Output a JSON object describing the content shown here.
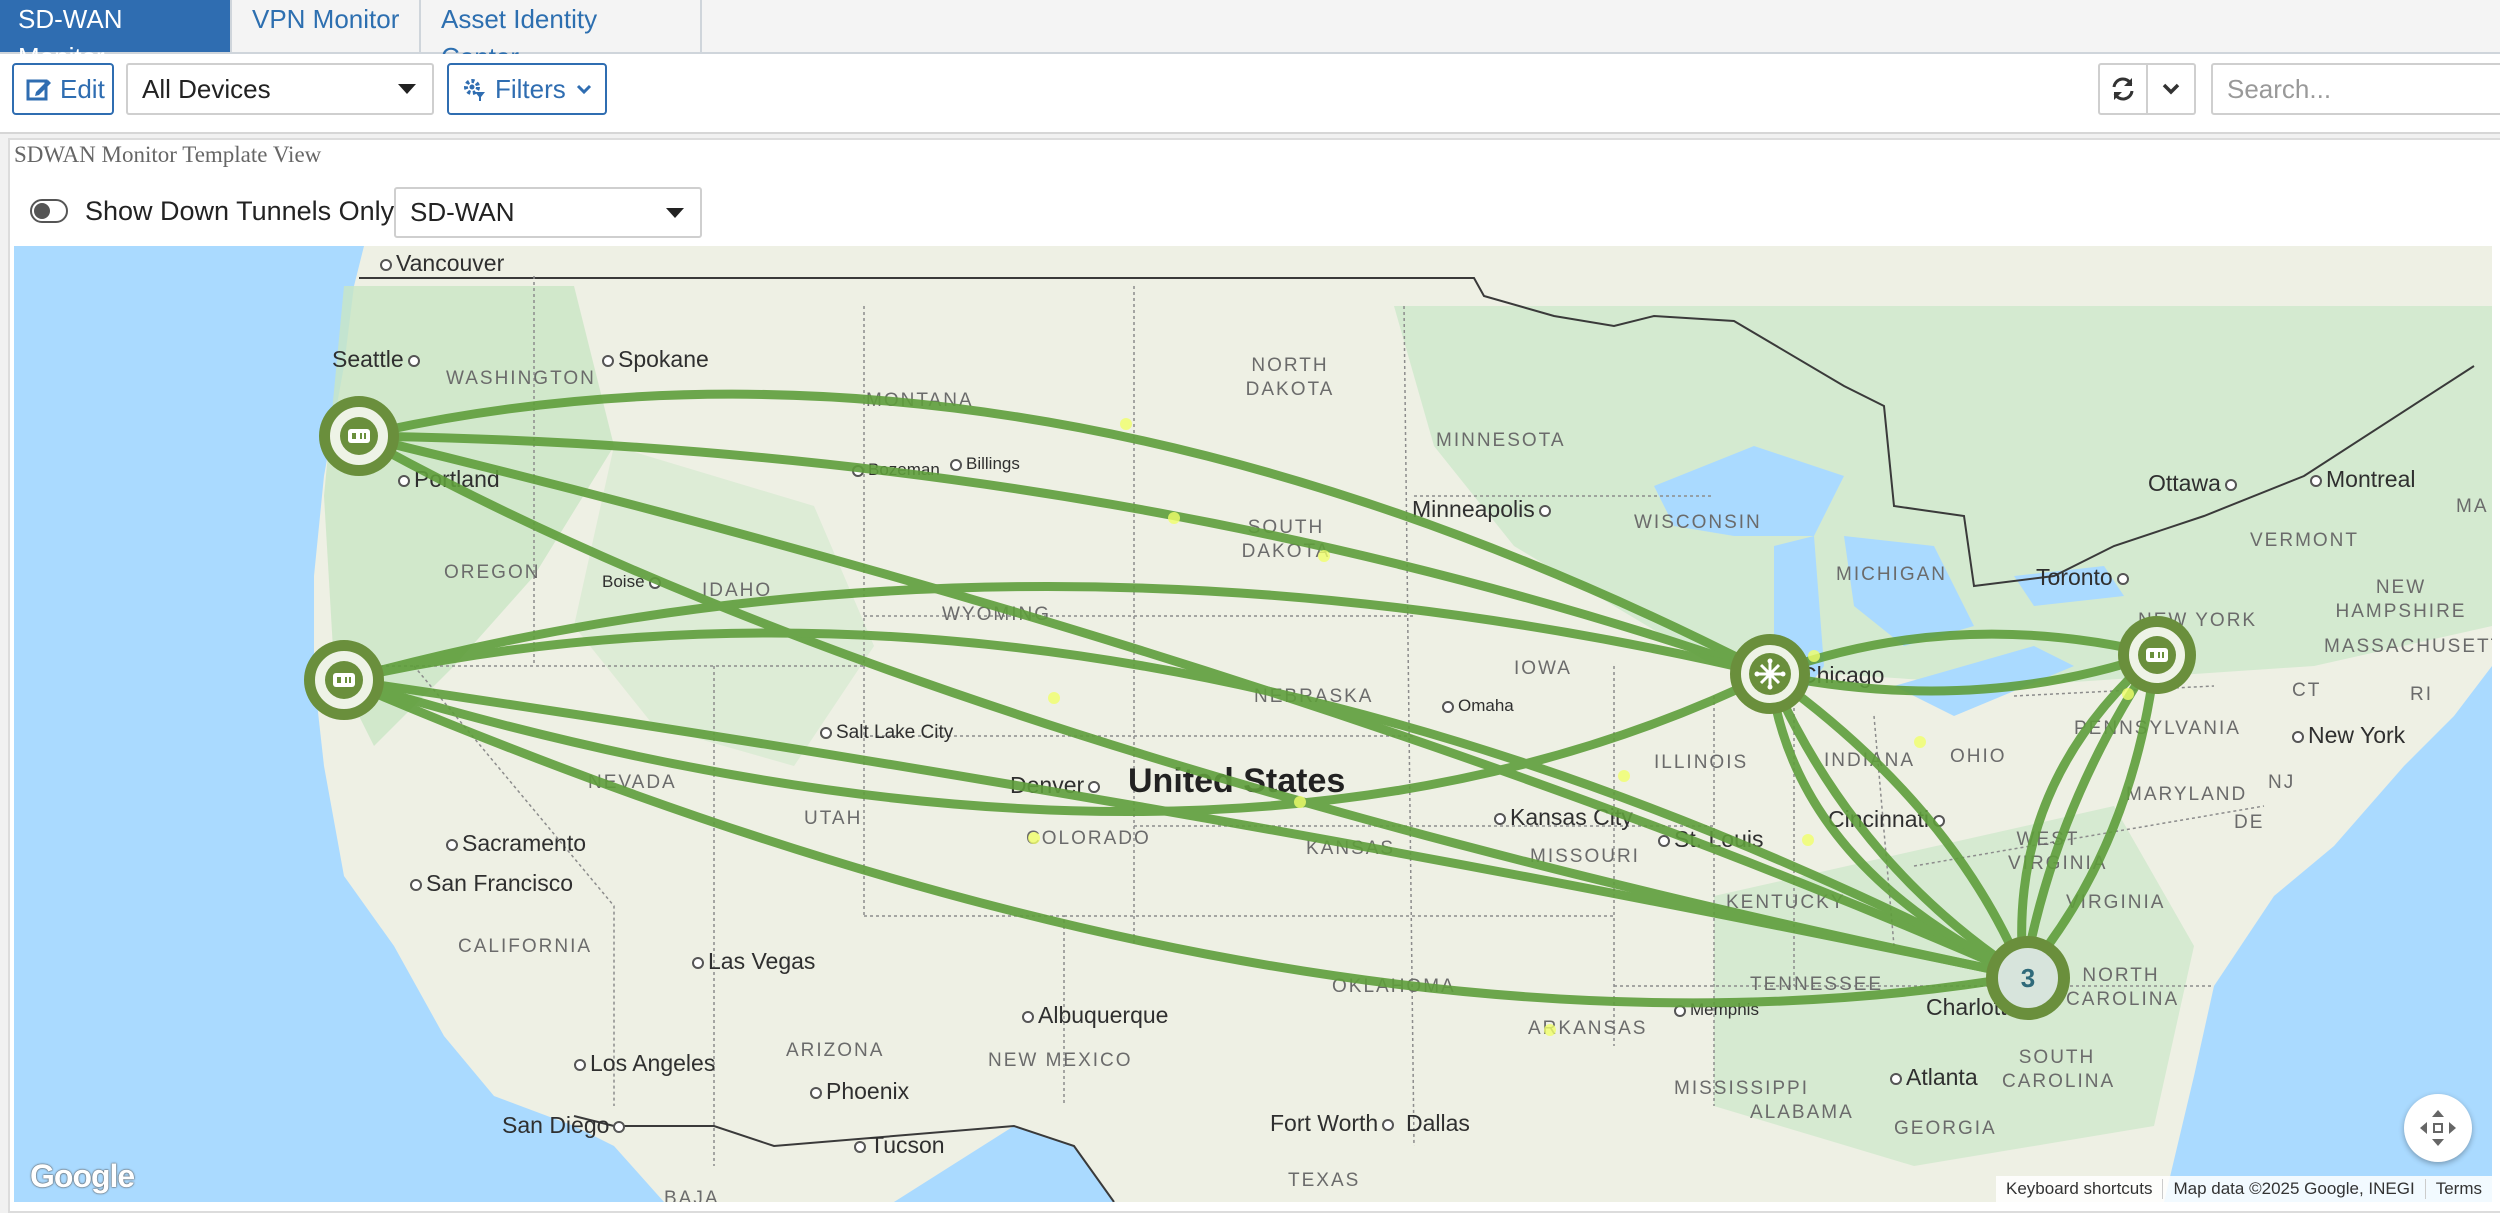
{
  "tabs": [
    {
      "label": "SD-WAN Monitor",
      "active": true
    },
    {
      "label": "VPN Monitor",
      "active": false
    },
    {
      "label": "Asset Identity Center",
      "active": false
    }
  ],
  "toolbar": {
    "edit_label": "Edit",
    "devices_select": "All Devices",
    "filters_label": "Filters",
    "search_placeholder": "Search..."
  },
  "panel": {
    "title": "SDWAN Monitor Template View",
    "toggle_label": "Show Down Tunnels Only",
    "toggle_on": false,
    "tunnel_select": "SD-WAN"
  },
  "map": {
    "country_label": "United States",
    "cities": [
      "Vancouver",
      "Seattle",
      "Spokane",
      "Portland",
      "Bozeman",
      "Billings",
      "Boise",
      "Salt Lake City",
      "Denver",
      "Sacramento",
      "San Francisco",
      "Las Vegas",
      "Los Angeles",
      "San Diego",
      "Phoenix",
      "Tucson",
      "Albuquerque",
      "Fort Worth",
      "Dallas",
      "Minneapolis",
      "Omaha",
      "Kansas City",
      "St. Louis",
      "Chicago",
      "Cincinnati",
      "Memphis",
      "Atlanta",
      "Charlotte",
      "Toronto",
      "Ottawa",
      "Montreal",
      "New York"
    ],
    "regions": [
      "WASHINGTON",
      "MONTANA",
      "NORTH DAKOTA",
      "MINNESOTA",
      "OREGON",
      "IDAHO",
      "SOUTH DAKOTA",
      "WISCONSIN",
      "MICHIGAN",
      "WYOMING",
      "IOWA",
      "NEBRASKA",
      "NEVADA",
      "UTAH",
      "COLORADO",
      "ILLINOIS",
      "INDIANA",
      "OHIO",
      "KANSAS",
      "MISSOURI",
      "CALIFORNIA",
      "KENTUCKY",
      "WEST VIRGINIA",
      "VIRGINIA",
      "PENNSYLVANIA",
      "NEW YORK",
      "VERMONT",
      "NEW HAMPSHIRE",
      "MASSACHUSETTS",
      "CT",
      "RI",
      "NJ",
      "DE",
      "MARYLAND",
      "ARIZONA",
      "NEW MEXICO",
      "OKLAHOMA",
      "TENNESSEE",
      "NORTH CAROLINA",
      "SOUTH CAROLINA",
      "ARKANSAS",
      "MISSISSIPPI",
      "ALABAMA",
      "GEORGIA",
      "TEXAS",
      "MA",
      "BAJA"
    ],
    "cluster_count": "3",
    "google_logo": "Google",
    "attribution": [
      "Keyboard shortcuts",
      "Map data ©2025 Google, INEGI",
      "Terms"
    ],
    "tunnel_color": "#5f9e3c",
    "node_color": "#6a8f3c"
  }
}
